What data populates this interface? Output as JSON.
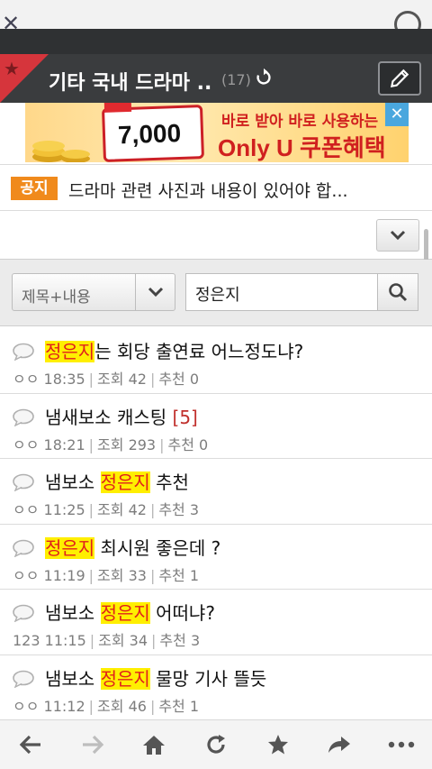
{
  "topbar": {
    "partial_text": ""
  },
  "board": {
    "title": "기타 국내 드라마 ..",
    "count": "(17)"
  },
  "ad": {
    "card_value": "7,000",
    "card_tag": "",
    "line1": "바로 받아 바로 사용하는",
    "line2": "Only U 쿠폰혜택",
    "close": "✕"
  },
  "notice": {
    "badge": "공지",
    "text": "드라마 관련 사진과 내용이 있어야 합..."
  },
  "search": {
    "scope_selected": "제목+내용",
    "query": "정은지"
  },
  "posts": [
    {
      "title_pre": "",
      "highlight": "정은지",
      "title_post": "는 회당 출연료 어느정도냐?",
      "comments": "",
      "author": "ㅇㅇ",
      "time": "18:35",
      "views": "조회 42",
      "recommends": "추천 0"
    },
    {
      "title_pre": "냄새보소 캐스팅 ",
      "highlight": "",
      "title_post": "",
      "comments": "[5]",
      "author": "ㅇㅇ",
      "time": "18:21",
      "views": "조회 293",
      "recommends": "추천 0"
    },
    {
      "title_pre": "냄보소 ",
      "highlight": "정은지",
      "title_post": " 추천",
      "comments": "",
      "author": "ㅇㅇ",
      "time": "11:25",
      "views": "조회 42",
      "recommends": "추천 3"
    },
    {
      "title_pre": "",
      "highlight": "정은지",
      "title_post": " 최시원 좋은데 ?",
      "comments": "",
      "author": "ㅇㅇ",
      "time": "11:19",
      "views": "조회 33",
      "recommends": "추천 1"
    },
    {
      "title_pre": "냄보소 ",
      "highlight": "정은지",
      "title_post": " 어떠냐?",
      "comments": "",
      "author": "123",
      "time": "11:15",
      "views": "조회 34",
      "recommends": "추천 3"
    },
    {
      "title_pre": "냄보소 ",
      "highlight": "정은지",
      "title_post": " 물망 기사 뜰듯",
      "comments": "",
      "author": "ㅇㅇ",
      "time": "11:12",
      "views": "조회 46",
      "recommends": "추천 1"
    }
  ],
  "icons": {
    "favorite": "star-icon",
    "refresh": "refresh-icon",
    "edit": "pencil-icon",
    "dropdown": "chevron-down-icon",
    "search": "search-icon",
    "post": "speech-bubble-icon",
    "nav": [
      "back-arrow-icon",
      "forward-arrow-icon",
      "home-icon",
      "reload-icon",
      "star-icon",
      "share-icon",
      "more-icon"
    ]
  },
  "colors": {
    "header_bg": "#3a3c3e",
    "favorite_red": "#d6353c",
    "notice_orange": "#f08a1c",
    "highlight_yellow": "#ffef00",
    "highlight_text": "#e0201c"
  }
}
